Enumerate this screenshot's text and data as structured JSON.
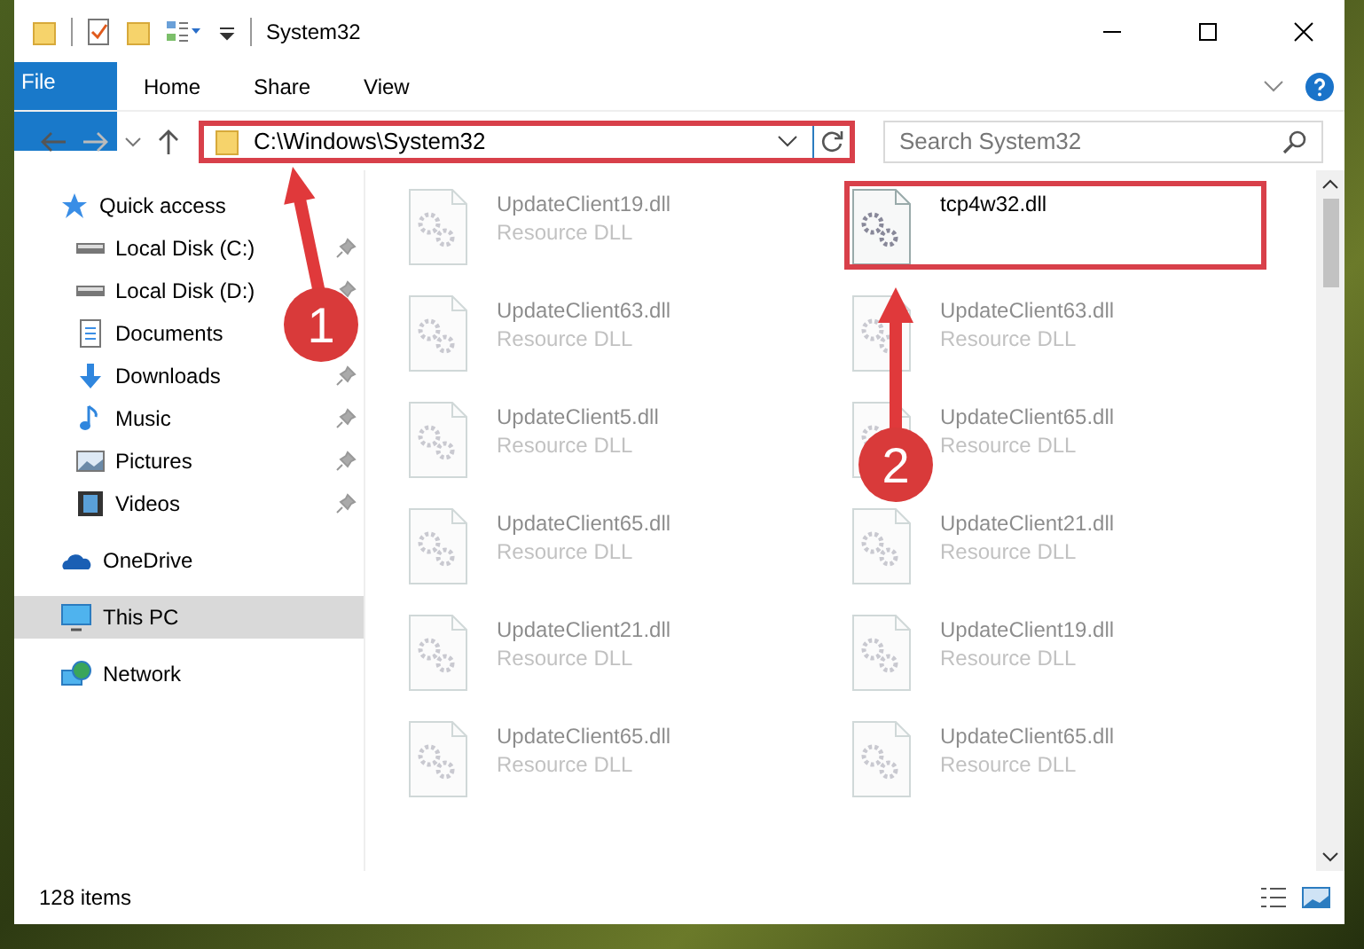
{
  "window": {
    "title": "System32"
  },
  "ribbon_tabs": [
    {
      "label": "File",
      "kind": "file"
    },
    {
      "label": "Home",
      "kind": "tab"
    },
    {
      "label": "Share",
      "kind": "tab"
    },
    {
      "label": "View",
      "kind": "tab"
    }
  ],
  "address_bar": {
    "path": "C:\\Windows\\System32",
    "highlighted": true
  },
  "search": {
    "placeholder": "Search System32"
  },
  "sidebar": {
    "items": [
      {
        "label": "Quick access",
        "kind": "star",
        "selected": false,
        "children": [
          {
            "label": "Local Disk (C:)",
            "kind": "drive",
            "selected": false,
            "pinned": true
          },
          {
            "label": "Local Disk (D:)",
            "kind": "drive",
            "selected": false,
            "pinned": true
          },
          {
            "label": "Documents",
            "kind": "documents",
            "selected": false
          },
          {
            "label": "Downloads",
            "kind": "downloads",
            "selected": false,
            "pinned": true
          },
          {
            "label": "Music",
            "kind": "music",
            "selected": false,
            "pinned": true
          },
          {
            "label": "Pictures",
            "kind": "pictures",
            "selected": false,
            "pinned": true
          },
          {
            "label": "Videos",
            "kind": "videos",
            "selected": false,
            "pinned": true
          }
        ]
      },
      {
        "label": "OneDrive",
        "kind": "cloud",
        "selected": false
      },
      {
        "label": "This PC",
        "kind": "pc",
        "selected": true
      },
      {
        "label": "Network",
        "kind": "network",
        "selected": false
      }
    ]
  },
  "files": [
    {
      "name": "UpdateClient19.dll",
      "type": "Resource DLL",
      "highlighted": false
    },
    {
      "name": "tcp4w32.dll",
      "highlighted": true
    },
    {
      "name": "UpdateClient63.dll",
      "type": "Resource DLL",
      "highlighted": false
    },
    {
      "name": "UpdateClient63.dll",
      "type": "Resource DLL",
      "highlighted": false
    },
    {
      "name": "UpdateClient5.dll",
      "type": "Resource DLL",
      "highlighted": false
    },
    {
      "name": "UpdateClient65.dll",
      "type": "Resource DLL",
      "highlighted": false
    },
    {
      "name": "UpdateClient65.dll",
      "type": "Resource DLL",
      "highlighted": false
    },
    {
      "name": "UpdateClient21.dll",
      "type": "Resource DLL",
      "highlighted": false
    },
    {
      "name": "UpdateClient21.dll",
      "type": "Resource DLL",
      "highlighted": false
    },
    {
      "name": "UpdateClient19.dll",
      "type": "Resource DLL",
      "highlighted": false
    },
    {
      "name": "UpdateClient65.dll",
      "type": "Resource DLL",
      "highlighted": false
    },
    {
      "name": "UpdateClient65.dll",
      "type": "Resource DLL",
      "highlighted": false
    }
  ],
  "status_bar": {
    "item_count": "128 items"
  },
  "annotations": [
    {
      "label": "1"
    },
    {
      "label": "2"
    }
  ]
}
